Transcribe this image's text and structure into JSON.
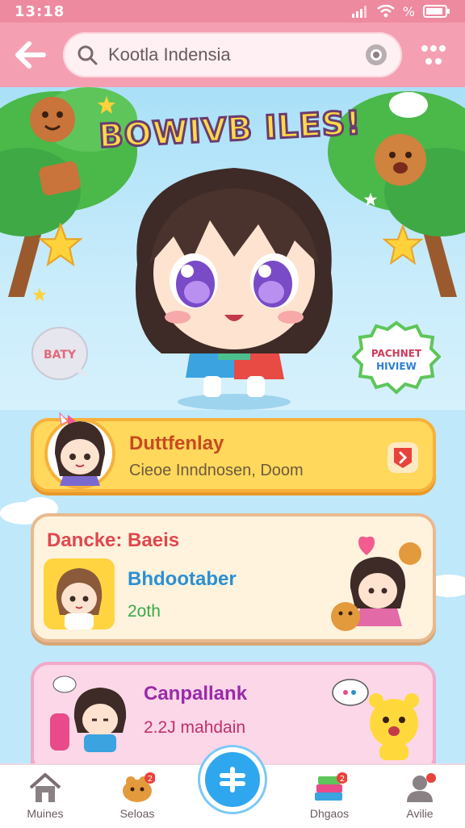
{
  "status_bar": {
    "time": "13:18",
    "battery_label": "%"
  },
  "search": {
    "query": "Kootla Indensia"
  },
  "hero": {
    "title": "BOWIVB ILES!",
    "bubble_left": "BATY",
    "bubble_right_lines": [
      "PACHNET",
      "HIVIEW"
    ]
  },
  "cards": [
    {
      "title": "Duttfenlay",
      "subtitle": "Cieoe Inndnosen, Doom"
    },
    {
      "title": "Dancke: Baeis",
      "name": "Bhdootaber",
      "count": "2oth"
    },
    {
      "title": "Canpallank",
      "subtitle": "2.2J mahdain"
    }
  ],
  "nav": {
    "items": [
      {
        "label": "Muines",
        "icon": "home-icon"
      },
      {
        "label": "Seloas",
        "icon": "pet-icon",
        "badge": "2"
      },
      {
        "label": "",
        "icon": "add-icon"
      },
      {
        "label": "Dhgaos",
        "icon": "books-icon",
        "badge": "2"
      },
      {
        "label": "Avilie",
        "icon": "profile-icon",
        "badge": ""
      }
    ]
  },
  "colors": {
    "header": "#f4a0b2",
    "accent_blue": "#2fa7ee",
    "card_yellow": "#ffd85c",
    "card_cream": "#fff3de",
    "card_pink": "#fcd7e8"
  }
}
